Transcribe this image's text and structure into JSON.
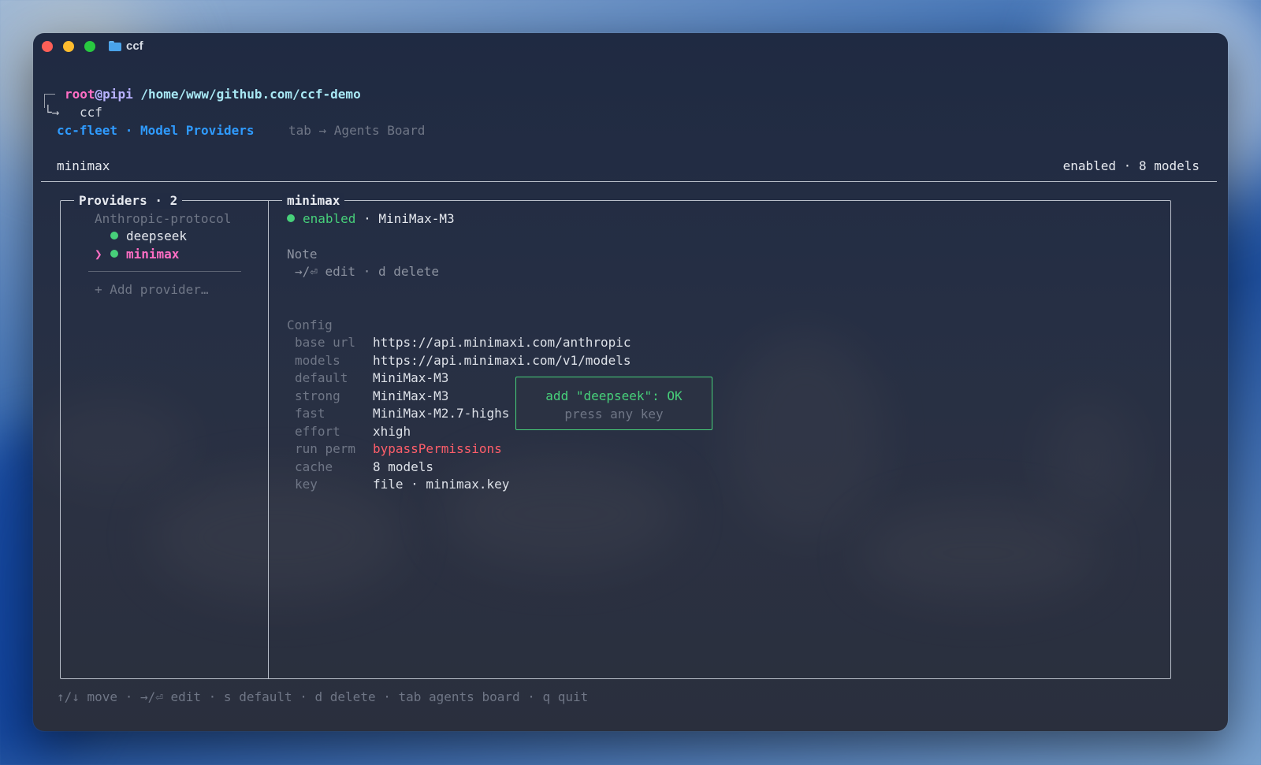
{
  "window": {
    "title": "ccf"
  },
  "prompt": {
    "user": "root",
    "at": "@",
    "host": "pipi",
    "path": "/home/www/github.com/ccf-demo",
    "arrow": "└→",
    "command": "ccf"
  },
  "header": {
    "app": "cc-fleet",
    "sep": "·",
    "page": "Model Providers",
    "hint": "tab → Agents Board"
  },
  "status_bar": {
    "name": "minimax",
    "summary": "enabled · 8 models"
  },
  "providers_panel": {
    "title": "Providers · 2",
    "group": "Anthropic-protocol",
    "items": [
      {
        "name": "deepseek",
        "status": "enabled",
        "selected": false
      },
      {
        "name": "minimax",
        "status": "enabled",
        "selected": true
      }
    ],
    "cursor": "❯",
    "add_label": "+ Add provider…"
  },
  "detail_panel": {
    "title": "minimax",
    "status": "enabled",
    "sep": "·",
    "model": "MiniMax-M3",
    "note_heading": "Note",
    "note_hint": "→/⏎ edit · d delete",
    "config_heading": "Config",
    "config": [
      {
        "key": "base url",
        "value": "https://api.minimaxi.com/anthropic"
      },
      {
        "key": "models",
        "value": "https://api.minimaxi.com/v1/models"
      },
      {
        "key": "default",
        "value": "MiniMax-M3"
      },
      {
        "key": "strong",
        "value": "MiniMax-M3"
      },
      {
        "key": "fast",
        "value": "MiniMax-M2.7-highs"
      },
      {
        "key": "effort",
        "value": "xhigh"
      },
      {
        "key": "run perm",
        "value": "bypassPermissions"
      },
      {
        "key": "cache",
        "value": "8 models"
      },
      {
        "key": "key",
        "value": "file · minimax.key"
      }
    ]
  },
  "toast": {
    "message": "add \"deepseek\": OK",
    "hint": "press any key"
  },
  "footer": {
    "keys": "↑/↓ move · →/⏎ edit · s default · d delete · tab agents board · q quit"
  },
  "colors": {
    "accent_blue": "#2f9bff",
    "pink": "#ff6ec4",
    "green": "#47d07a",
    "red": "#ff5e6a"
  }
}
